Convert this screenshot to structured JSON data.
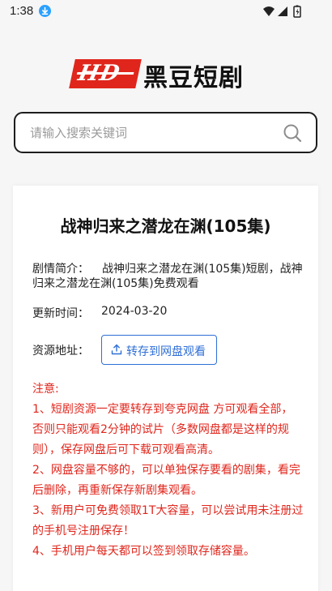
{
  "status_bar": {
    "time": "1:38"
  },
  "logo": {
    "badge": "HD",
    "text": "黑豆短剧"
  },
  "search": {
    "placeholder": "请输入搜索关键词"
  },
  "detail": {
    "title": "战神归来之潜龙在渊(105集)",
    "intro_label": "剧情简介：",
    "intro_text": "战神归来之潜龙在渊(105集)短剧，战神归来之潜龙在渊(105集)免费观看",
    "update_label": "更新时间：",
    "update_value": "2024-03-20",
    "source_label": "资源地址：",
    "save_button": "转存到网盘观看"
  },
  "notice": {
    "heading": "注意:",
    "items": [
      "1、短剧资源一定要转存到夸克网盘 方可观看全部，否则只能观看2分钟的试片（多数网盘都是这样的规则），保存网盘后可下载可观看高清。",
      "2、网盘容量不够的，可以单独保存要看的剧集，看完后删除，再重新保存新剧集观看。",
      "3、新用户可免费领取1T大容量，可以尝试用未注册过的手机号注册保存！",
      "4、手机用户每天都可以签到领取存储容量。"
    ]
  },
  "colors": {
    "accent": "#2f6fd6",
    "brand_red": "#e0261c",
    "notice_red": "#e0261c"
  }
}
